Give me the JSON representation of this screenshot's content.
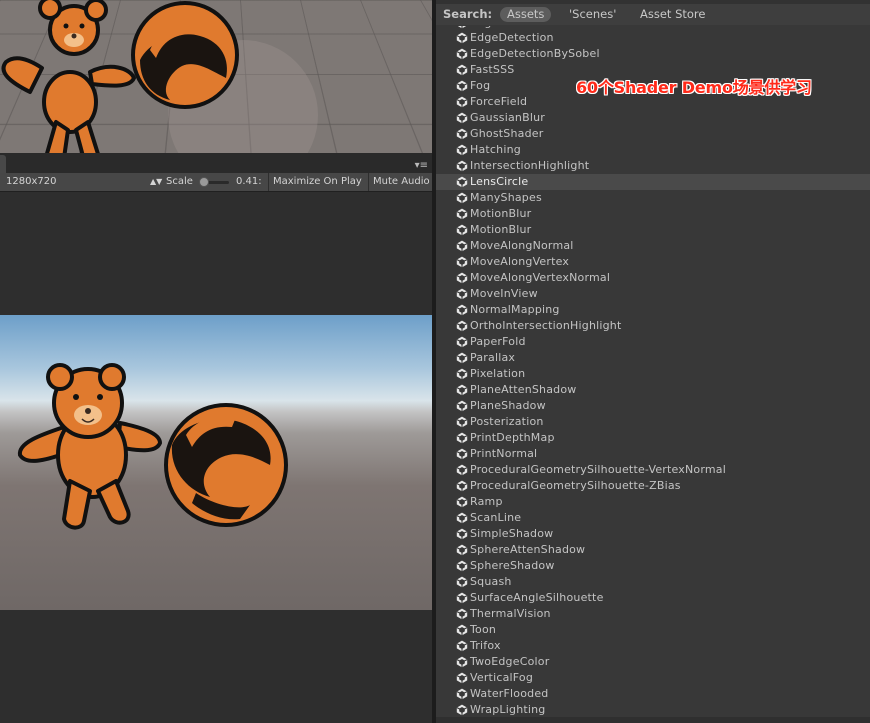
{
  "game_toolbar": {
    "resolution": "1280x720",
    "scale_label": "Scale",
    "scale_value": "0.41:",
    "maximize_label": "Maximize On Play",
    "mute_label": "Mute Audio",
    "menu_glyph": "▾≡"
  },
  "project": {
    "search_label": "Search:",
    "scopes": [
      "Assets",
      "'Scenes'",
      "Asset Store"
    ],
    "partial_top_item": "EdgeColor",
    "items": [
      "EdgeDetection",
      "EdgeDetectionBySobel",
      "FastSSS",
      "Fog",
      "ForceField",
      "GaussianBlur",
      "GhostShader",
      "Hatching",
      "IntersectionHighlight",
      "LensCircle",
      "ManyShapes",
      "MotionBlur",
      "MotionBlur",
      "MoveAlongNormal",
      "MoveAlongVertex",
      "MoveAlongVertexNormal",
      "MoveInView",
      "NormalMapping",
      "OrthoIntersectionHighlight",
      "PaperFold",
      "Parallax",
      "Pixelation",
      "PlaneAttenShadow",
      "PlaneShadow",
      "Posterization",
      "PrintDepthMap",
      "PrintNormal",
      "ProceduralGeometrySilhouette-VertexNormal",
      "ProceduralGeometrySilhouette-ZBias",
      "Ramp",
      "ScanLine",
      "SimpleShadow",
      "SphereAttenShadow",
      "SphereShadow",
      "Squash",
      "SurfaceAngleSilhouette",
      "ThermalVision",
      "Toon",
      "Trifox",
      "TwoEdgeColor",
      "VerticalFog",
      "WaterFlooded",
      "WrapLighting"
    ],
    "selected_item": "LensCircle",
    "item_icon": "unity-scene-icon"
  },
  "annotation": "60个Shader Demo场景供学习",
  "colors": {
    "annotation": "#ff2a1a",
    "bear": "#e07a2e",
    "outline": "#111111"
  }
}
